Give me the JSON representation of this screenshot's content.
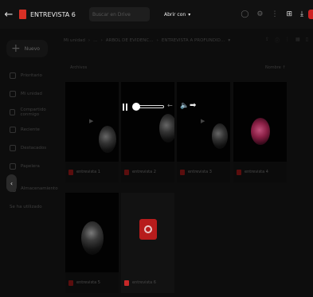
{
  "topbar": {
    "back_label": "←",
    "doc_title": "ENTREVISTA 6",
    "search_placeholder": "Buscar en Drive",
    "open_with": "Abrir con",
    "open_with_caret": "▾",
    "icons": [
      "help-icon",
      "settings-icon",
      "apps-icon",
      "add-to-drive-icon",
      "download-icon"
    ]
  },
  "sidebar": {
    "new_label": "Nuevo",
    "items": [
      {
        "label": "Prioritario",
        "icon": "check-icon"
      },
      {
        "label": "Mi unidad",
        "icon": "drive-icon"
      },
      {
        "label": "Compartido conmigo",
        "icon": "people-icon"
      },
      {
        "label": "Reciente",
        "icon": "clock-icon"
      },
      {
        "label": "Destacados",
        "icon": "star-icon"
      },
      {
        "label": "Papelera",
        "icon": "trash-icon"
      },
      {
        "label": "Almacenamiento",
        "icon": "cloud-icon"
      },
      {
        "label": "Se ha utilizado",
        "icon": ""
      }
    ],
    "collapse_glyph": "‹"
  },
  "breadcrumbs": [
    "Mi unidad",
    "›",
    "…",
    "›",
    "ARBOL DE EVIDENC…",
    "›",
    "ENTREVISTA A PROFUNDID…",
    "▾"
  ],
  "list_label": "Archivos",
  "sort_label": "Nombre ↑",
  "files": [
    {
      "name": "entrevista 1"
    },
    {
      "name": "entrevista 2"
    },
    {
      "name": "entrevista 3"
    },
    {
      "name": "entrevista 4"
    },
    {
      "name": "entrevista 5"
    },
    {
      "name": "entrevista 6"
    }
  ],
  "player": {
    "pause": "pause-icon",
    "volume_glyph": "🔈",
    "forward_glyph": "➡"
  }
}
